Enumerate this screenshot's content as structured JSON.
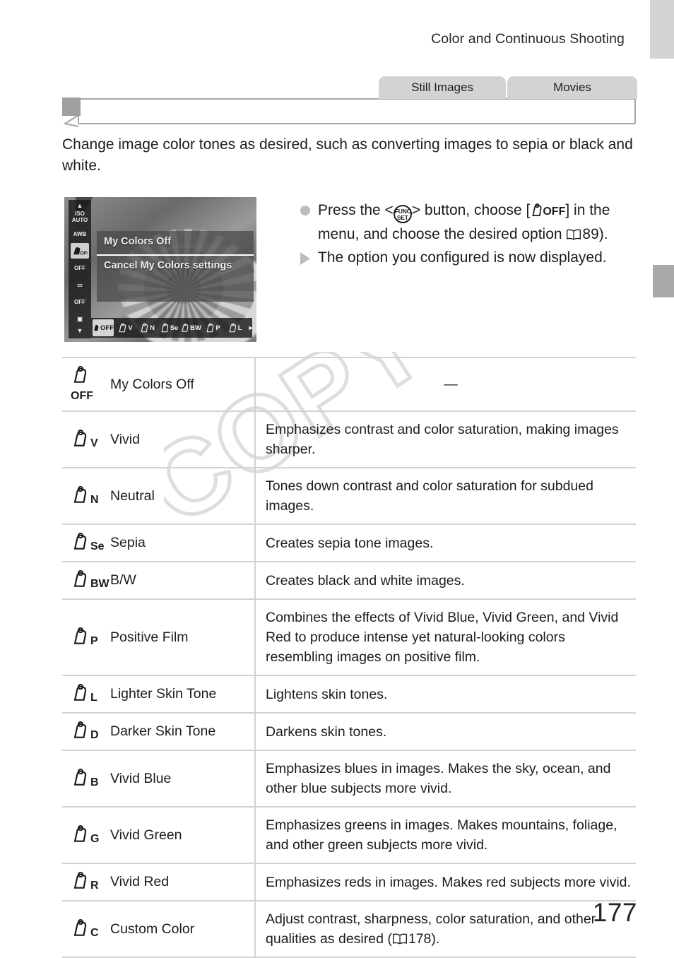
{
  "page": {
    "header": "Color and Continuous Shooting",
    "number": "177",
    "watermark": "COPY"
  },
  "mode_tabs": [
    {
      "label": "Still Images",
      "name": "still-images"
    },
    {
      "label": "Movies",
      "name": "movies"
    }
  ],
  "section": {
    "title": "",
    "intro": "Change image color tones as desired, such as converting images to sepia or black and white."
  },
  "lcd": {
    "side_icons": [
      {
        "line1": "ISO",
        "line2": "AUTO",
        "selected": false
      },
      {
        "line1": "AWB",
        "line2": "",
        "selected": false
      },
      {
        "line1": "OFF",
        "line2": "",
        "selected": true
      },
      {
        "line1": "OFF",
        "line2": "",
        "selected": false
      },
      {
        "line1": "▭",
        "line2": "",
        "selected": false
      },
      {
        "line1": "OFF",
        "line2": "",
        "selected": false
      },
      {
        "line1": "▣",
        "line2": "",
        "selected": false
      }
    ],
    "menu_title": "My Colors Off",
    "menu_body": "Cancel My Colors settings",
    "options": [
      {
        "sub": "OFF",
        "selected": true
      },
      {
        "sub": "V",
        "selected": false
      },
      {
        "sub": "N",
        "selected": false
      },
      {
        "sub": "Se",
        "selected": false
      },
      {
        "sub": "BW",
        "selected": false
      },
      {
        "sub": "P",
        "selected": false
      },
      {
        "sub": "L",
        "selected": false
      }
    ],
    "next_arrow": "▸"
  },
  "instructions": [
    {
      "bullet": "dot",
      "pre": "Press the <",
      "button_l1": "FUNC.",
      "button_l2": "SET",
      "mid": "> button, choose [",
      "icon_sub": "OFF",
      "post": "] in the menu, and choose the desired option ",
      "ref_page": "89",
      "tail": ")."
    },
    {
      "bullet": "triangle",
      "text": "The option you configured is now displayed."
    }
  ],
  "table": {
    "rows": [
      {
        "icon_sub": "OFF",
        "name": "My Colors Off",
        "desc": "—",
        "center": true
      },
      {
        "icon_sub": "V",
        "name": "Vivid",
        "desc": "Emphasizes contrast and color saturation, making images sharper."
      },
      {
        "icon_sub": "N",
        "name": "Neutral",
        "desc": "Tones down contrast and color saturation for subdued images."
      },
      {
        "icon_sub": "Se",
        "name": "Sepia",
        "desc": "Creates sepia tone images."
      },
      {
        "icon_sub": "BW",
        "name": "B/W",
        "desc": "Creates black and white images."
      },
      {
        "icon_sub": "P",
        "name": "Positive Film",
        "desc": "Combines the effects of Vivid Blue, Vivid Green, and Vivid Red to produce intense yet natural-looking colors resembling images on positive film."
      },
      {
        "icon_sub": "L",
        "name": "Lighter Skin Tone",
        "desc": "Lightens skin tones."
      },
      {
        "icon_sub": "D",
        "name": "Darker Skin Tone",
        "desc": "Darkens skin tones."
      },
      {
        "icon_sub": "B",
        "name": "Vivid Blue",
        "desc": "Emphasizes blues in images. Makes the sky, ocean, and other blue subjects more vivid."
      },
      {
        "icon_sub": "G",
        "name": "Vivid Green",
        "desc": "Emphasizes greens in images. Makes mountains, foliage, and other green subjects more vivid."
      },
      {
        "icon_sub": "R",
        "name": "Vivid Red",
        "desc": "Emphasizes reds in images. Makes red subjects more vivid."
      },
      {
        "icon_sub": "C",
        "name": "Custom Color",
        "desc_pre": "Adjust contrast, sharpness, color saturation, and other qualities as desired (",
        "ref_page": "178",
        "desc_post": ")."
      }
    ]
  },
  "colors": {
    "tab_gray": "#d3d3d3",
    "edge_tab_gray": "#d4d4d4",
    "edge_tab_dark": "#a9a9a9",
    "rule_gray": "#d2d2d2",
    "bullet_gray": "#bdbdbd",
    "watermark_gray": "#dedede",
    "text": "#1c1c1c"
  }
}
